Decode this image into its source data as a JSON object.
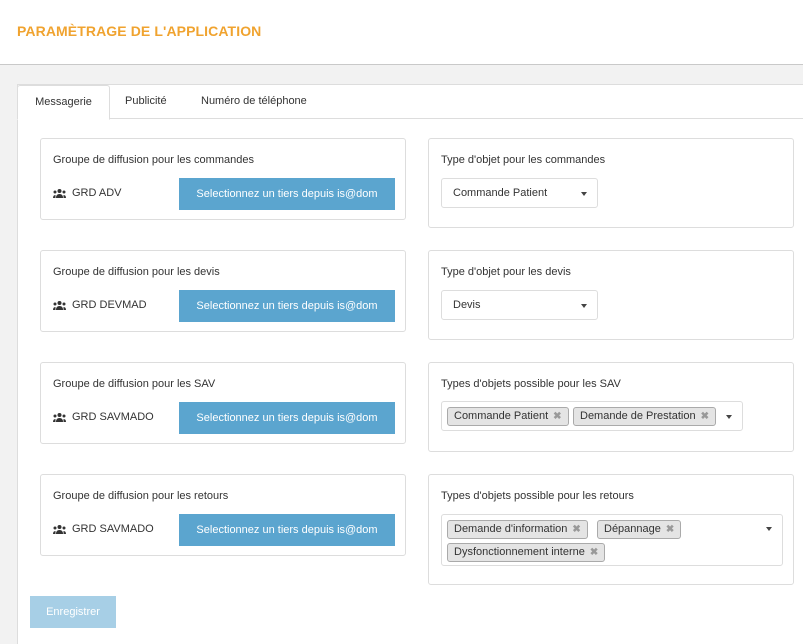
{
  "header": {
    "title": "PARAMÈTRAGE DE L'APPLICATION"
  },
  "tabs": [
    {
      "label": "Messagerie",
      "active": true
    },
    {
      "label": "Publicité",
      "active": false
    },
    {
      "label": "Numéro de téléphone",
      "active": false
    }
  ],
  "groups": [
    {
      "title": "Groupe de diffusion pour les commandes",
      "group_name": "GRD ADV",
      "button_label": "Selectionnez un tiers depuis is@dom"
    },
    {
      "title": "Groupe de diffusion pour les devis",
      "group_name": "GRD DEVMAD",
      "button_label": "Selectionnez un tiers depuis is@dom"
    },
    {
      "title": "Groupe de diffusion pour les SAV",
      "group_name": "GRD SAVMADO",
      "button_label": "Selectionnez un tiers depuis is@dom"
    },
    {
      "title": "Groupe de diffusion pour les retours",
      "group_name": "GRD SAVMADO",
      "button_label": "Selectionnez un tiers depuis is@dom"
    }
  ],
  "object_types": [
    {
      "title": "Type d'objet pour les commandes",
      "selected": "Commande Patient"
    },
    {
      "title": "Type d'objet pour les devis",
      "selected": "Devis"
    },
    {
      "title": "Types d'objets possible pour les SAV",
      "chips": [
        "Commande Patient",
        "Demande de Prestation"
      ]
    },
    {
      "title": "Types d'objets possible pour les retours",
      "chips": [
        "Demande d'information",
        "Dépannage",
        "Dysfonctionnement interne"
      ]
    }
  ],
  "chip_remove_glyph": "✖",
  "save_label": "Enregistrer",
  "colors": {
    "accent": "#f0a32f",
    "primary_button": "#5ba5cf",
    "disabled_button": "#a7cfe6"
  }
}
